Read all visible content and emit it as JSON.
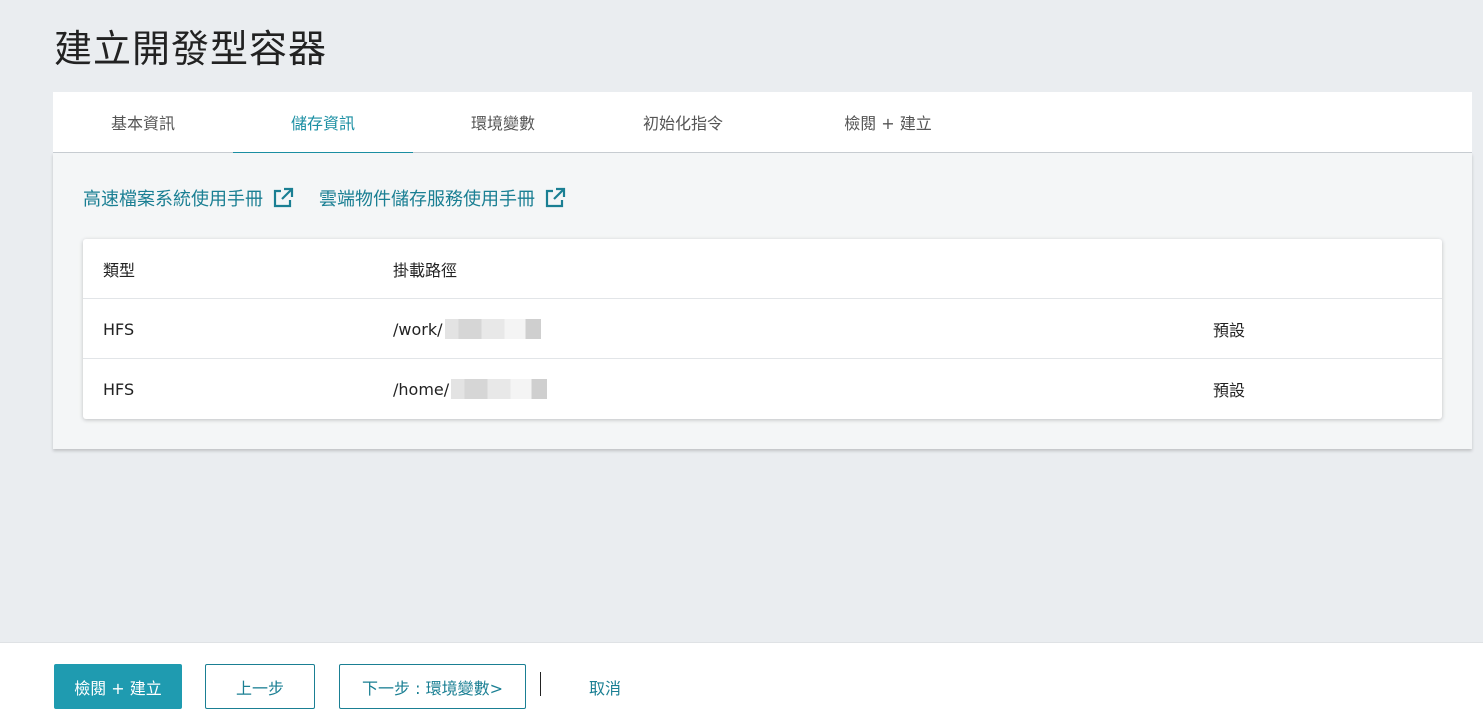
{
  "page": {
    "title": "建立開發型容器"
  },
  "tabs": [
    {
      "label": "基本資訊",
      "active": false
    },
    {
      "label": "儲存資訊",
      "active": true
    },
    {
      "label": "環境變數",
      "active": false
    },
    {
      "label": "初始化指令",
      "active": false
    },
    {
      "label": "檢閱 + 建立",
      "active": false
    }
  ],
  "links": {
    "hfs_manual": "高速檔案系統使用手冊",
    "object_storage_manual": "雲端物件儲存服務使用手冊"
  },
  "table": {
    "headers": {
      "type": "類型",
      "mount_path": "掛載路徑"
    },
    "rows": [
      {
        "type": "HFS",
        "mount_path": "/work/",
        "flag": "預設"
      },
      {
        "type": "HFS",
        "mount_path": "/home/",
        "flag": "預設"
      }
    ]
  },
  "footer": {
    "review_create": "檢閱 + 建立",
    "prev": "上一步",
    "next": "下一步 : 環境變數>",
    "cancel": "取消"
  },
  "colors": {
    "accent": "#1b8fa3",
    "primary_button": "#1f9bb0",
    "background": "#eaedf0"
  }
}
